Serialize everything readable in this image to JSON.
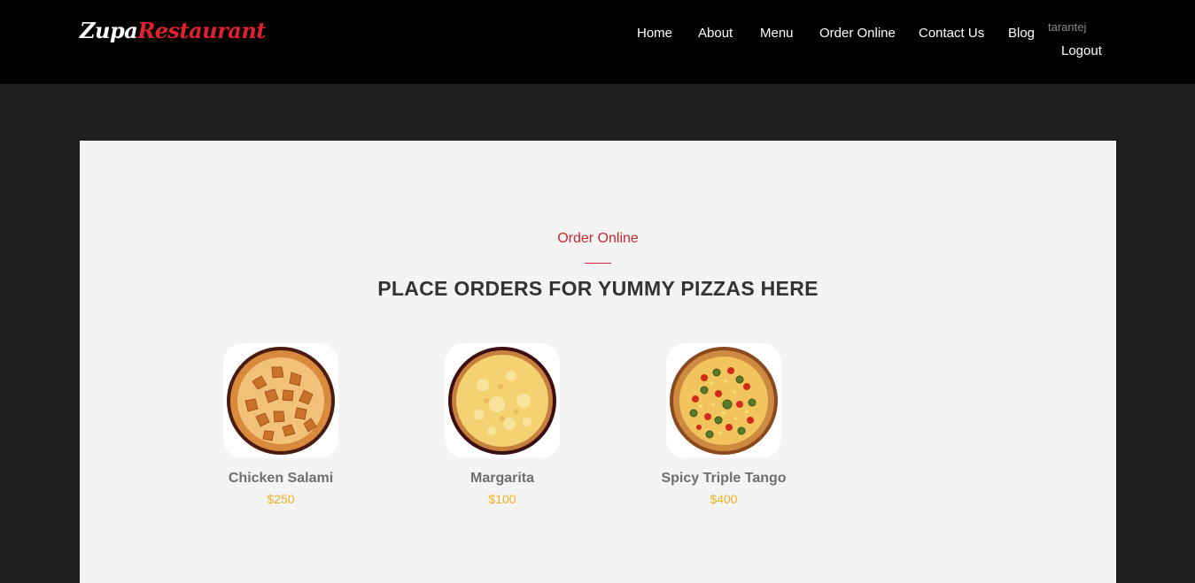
{
  "header": {
    "logo_part1": "Zupa",
    "logo_part2": "Restaurant",
    "nav": [
      "Home",
      "About",
      "Menu",
      "Order Online",
      "Contact Us",
      "Blog"
    ],
    "user": "tarantej",
    "logout_label": "Logout"
  },
  "section": {
    "subtitle": "Order Online",
    "title": "PLACE ORDERS FOR YUMMY PIZZAS HERE"
  },
  "menu_items": [
    {
      "name": "Chicken Salami",
      "price": "$250",
      "icon": "chicken-salami-pizza-icon"
    },
    {
      "name": "Margarita",
      "price": "$100",
      "icon": "margarita-pizza-icon"
    },
    {
      "name": "Spicy Triple Tango",
      "price": "$400",
      "icon": "spicy-triple-tango-pizza-icon"
    }
  ],
  "colors": {
    "accent": "#c8272e",
    "price": "#f0b121",
    "header_bg": "#000000",
    "page_bg": "#1f1f1f",
    "panel_bg": "#f4f4f4"
  }
}
